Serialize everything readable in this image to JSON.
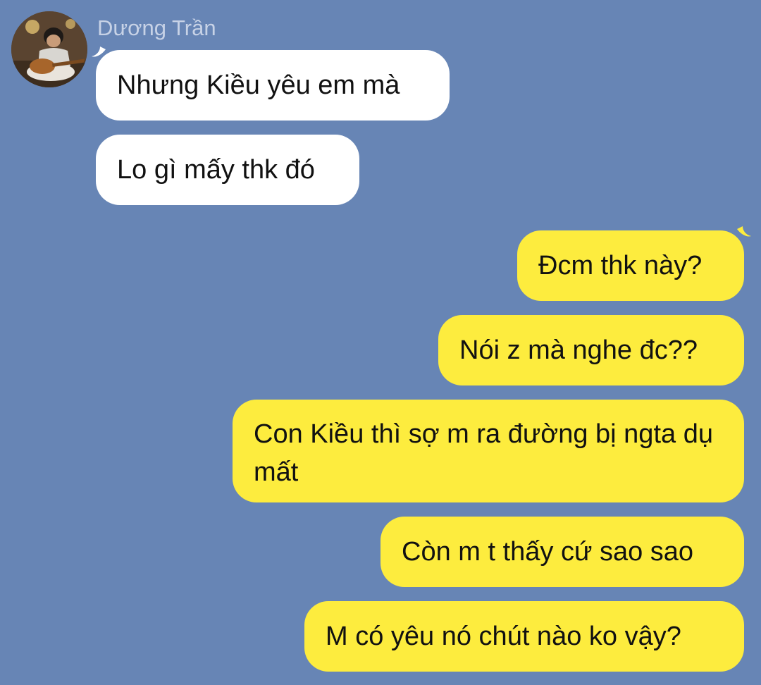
{
  "contact": {
    "name": "Dương Trần",
    "avatar_icon": "avatar-guitar-photo"
  },
  "messages": [
    {
      "side": "incoming",
      "text": "Nhưng Kiều yêu em mà"
    },
    {
      "side": "incoming",
      "text": "Lo gì mấy thk đó"
    },
    {
      "side": "outgoing",
      "text": "Đcm thk này?"
    },
    {
      "side": "outgoing",
      "text": "Nói z mà nghe đc??"
    },
    {
      "side": "outgoing",
      "text": "Con Kiều thì sợ m ra đường bị ngta dụ mất"
    },
    {
      "side": "outgoing",
      "text": "Còn m t thấy cứ sao sao"
    },
    {
      "side": "outgoing",
      "text": "M có yêu nó chút nào ko vậy?"
    }
  ],
  "colors": {
    "background": "#6785b5",
    "incoming_bubble": "#ffffff",
    "outgoing_bubble": "#fdec3e",
    "name_text": "#c7d2e6"
  }
}
